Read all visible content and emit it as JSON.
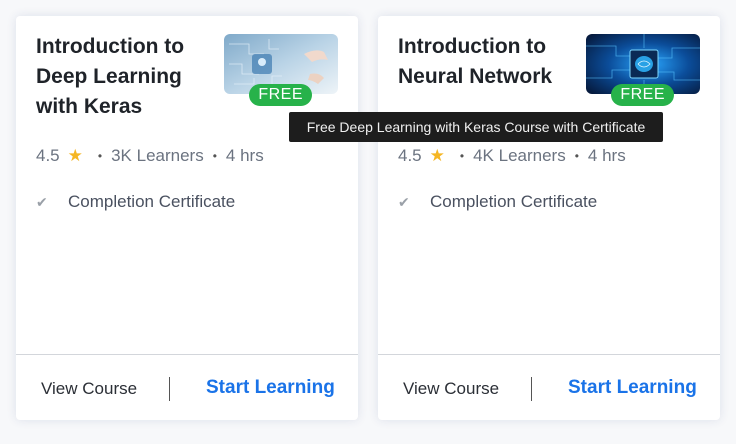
{
  "cards": [
    {
      "title": "Introduction to Deep Learning with Keras",
      "badge": "FREE",
      "rating": "4.5",
      "learners": "3K Learners",
      "duration": "4 hrs",
      "feature": "Completion Certificate",
      "view_label": "View Course",
      "start_label": "Start Learning"
    },
    {
      "title": "Introduction to Neural Network",
      "badge": "FREE",
      "rating": "4.5",
      "learners": "4K Learners",
      "duration": "4 hrs",
      "feature": "Completion Certificate",
      "view_label": "View Course",
      "start_label": "Start Learning"
    }
  ],
  "tooltip": "Free Deep Learning with Keras Course with Certificate",
  "icons": {
    "rating": "star-icon",
    "feature": "check-icon"
  },
  "colors": {
    "badge": "#27b24a",
    "star": "#f5b623",
    "link": "#1a73e8",
    "tooltip_bg": "#1d1d1d"
  }
}
